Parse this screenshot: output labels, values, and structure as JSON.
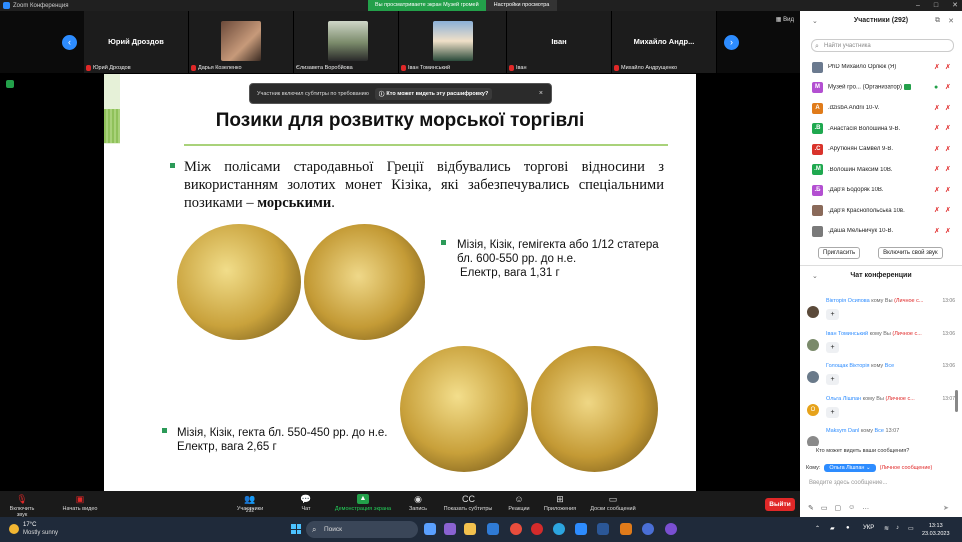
{
  "window": {
    "title": "Zoom Конференция",
    "view_banner": "Вы просматриваете экран Музей громей",
    "view_options": "Настройки просмотра",
    "layout_label": "Вид"
  },
  "gallery": {
    "tiles": [
      {
        "display_name": "Юрий Дроздов",
        "label": "Юрий Дроздов",
        "muted": true
      },
      {
        "display_name": "",
        "label": "Дарья Козеленко",
        "muted": false
      },
      {
        "display_name": "",
        "label": "Єлизавета Воробйова",
        "muted": false
      },
      {
        "display_name": "",
        "label": "Іван Томинський",
        "muted": true
      },
      {
        "display_name": "Іван",
        "label": "Іван",
        "muted": true
      },
      {
        "display_name": "Михайло  Андр...",
        "label": "Михайло Андрущенко",
        "muted": true
      }
    ]
  },
  "subtitle_popup": {
    "text": "Участник включил субтитры по требованию",
    "question": "Кто может видеть эту расшифровку?",
    "close": "×"
  },
  "slide": {
    "title": "Позики для розвитку морської торгівлі",
    "paragraph_plain": "Між полісами стародавньої Греції відбувались торгові відносини з використанням золотих монет Кізіка, які забезпечувались спеціальними позиками – ",
    "paragraph_bold": "морськими",
    "paragraph_end": ".",
    "caption1_line1": "Мізія, Кізік, гемігекта або 1/12 статера бл. 600-550 рр. до н.е.",
    "caption1_line2": "Електр, вага 1,31 г",
    "caption2_line1": "Мізія, Кізік, гекта бл. 550-450 рр. до н.е.",
    "caption2_line2": "Електр, вага 2,65 г"
  },
  "toolbar": {
    "unmute": "Включить звук",
    "start_video": "Начать видео",
    "participants": "Участники",
    "participants_count": "292",
    "chat": "Чат",
    "share": "Демонстрация экрана",
    "record": "Запись",
    "captions": "Показать субтитры",
    "reactions": "Реакции",
    "apps": "Приложения",
    "docs": "Доски сообщений",
    "leave": "Выйти"
  },
  "participants_panel": {
    "title": "Участники (292)",
    "search_placeholder": "Найти участника",
    "items": [
      {
        "initial": "",
        "name": "PhD Михайло Орлюк (Я)",
        "color": "#6b7a8f"
      },
      {
        "initial": "M",
        "name": "Музей гро...  (Организатор)",
        "color": "#b34fd1"
      },
      {
        "initial": "A",
        "name": ".dzisbA Andrii 10-V.",
        "color": "#e07b1a"
      },
      {
        "initial": ".B",
        "name": ".Анастасія Волошина 9-В.",
        "color": "#1fa84f"
      },
      {
        "initial": ".C",
        "name": ".Арутюнян Самвел 9-В.",
        "color": "#d9332b"
      },
      {
        "initial": ".M",
        "name": ".Волошин Максим 10В.",
        "color": "#1fa84f"
      },
      {
        "initial": ".Б",
        "name": ".Дар'я Бодоряк 10В.",
        "color": "#b34fd1"
      },
      {
        "initial": "",
        "name": ".Дар'я Краснопольська 10в.",
        "color": "#8a6a5a"
      },
      {
        "initial": "",
        "name": ".Даша Мельничук 10-В.",
        "color": "#7a7a7a"
      }
    ],
    "invite": "Пригласить",
    "unmute_self": "Включить свой звук"
  },
  "chat_panel": {
    "title": "Чат конференции",
    "messages": [
      {
        "from": "Вікторія Осипова",
        "to": "кому Вы",
        "private": "(Личное с...",
        "time": "13:06",
        "text": "+",
        "avatar": "#5b4a3a"
      },
      {
        "from": "Іван Томинський",
        "to": "кому Вы",
        "private": "(Личное с...",
        "time": "13:06",
        "text": "+",
        "avatar": "#7a8a6a"
      },
      {
        "from": "Голощак Вікторія",
        "to": "кому",
        "to_all": "Все",
        "private": "",
        "time": "13:06",
        "text": "+",
        "avatar": "#6a7a8a"
      },
      {
        "from": "Ольга Лішпан",
        "to": "кому Вы",
        "private": "(Личное с...",
        "time": "13:07",
        "text": "+",
        "avatar": "#e6a21a",
        "initial": "О"
      },
      {
        "from": "Maksym Danl",
        "to": "кому",
        "to_all": "Все",
        "private": "",
        "time": "13:07",
        "text": "",
        "avatar": "#8a8a8a"
      }
    ],
    "who_sees": "Кто может видеть ваши сообщения?",
    "to_label": "Кому:",
    "to_value": "Ольга Лішпан",
    "to_private": "(Личное сообщение)",
    "input_placeholder": "Введите здесь сообщение..."
  },
  "taskbar": {
    "temp": "17°C",
    "weather": "Mostly sunny",
    "search": "Поиск",
    "lang": "УКР",
    "time": "13:13",
    "date": "23.03.2023"
  }
}
